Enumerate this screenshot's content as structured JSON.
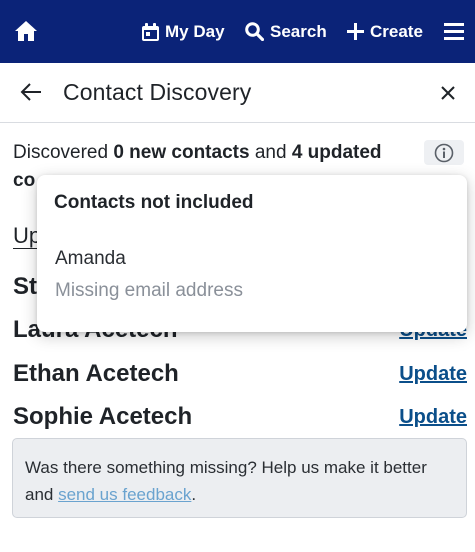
{
  "nav": {
    "my_day": "My Day",
    "search": "Search",
    "create": "Create",
    "icons": [
      "home-icon",
      "calendar-icon",
      "search-icon",
      "plus-icon",
      "menu-icon"
    ],
    "bar_color": "#0b2378"
  },
  "panel": {
    "title": "Contact Discovery"
  },
  "summary": {
    "prefix": "Discovered ",
    "new_count": "0 new contacts",
    "middle": " and ",
    "updated_count": "4 updated",
    "line2": "co"
  },
  "section": {
    "heading": "Up"
  },
  "contacts": [
    {
      "name": "St",
      "action": ""
    },
    {
      "name": "Laura Acetech",
      "action": "Update"
    },
    {
      "name": "Ethan Acetech",
      "action": "Update"
    },
    {
      "name": "Sophie Acetech",
      "action": "Update"
    }
  ],
  "feedback": {
    "text": "Was there something missing? Help us make it better and ",
    "link": "send us feedback",
    "suffix": "."
  },
  "popover": {
    "title": "Contacts not included",
    "items": [
      {
        "name": "Amanda",
        "reason": "Missing email address"
      }
    ]
  },
  "colors": {
    "link": "#0b4f8a",
    "feedback_link": "#6aa3cf",
    "muted": "#8a9099"
  }
}
